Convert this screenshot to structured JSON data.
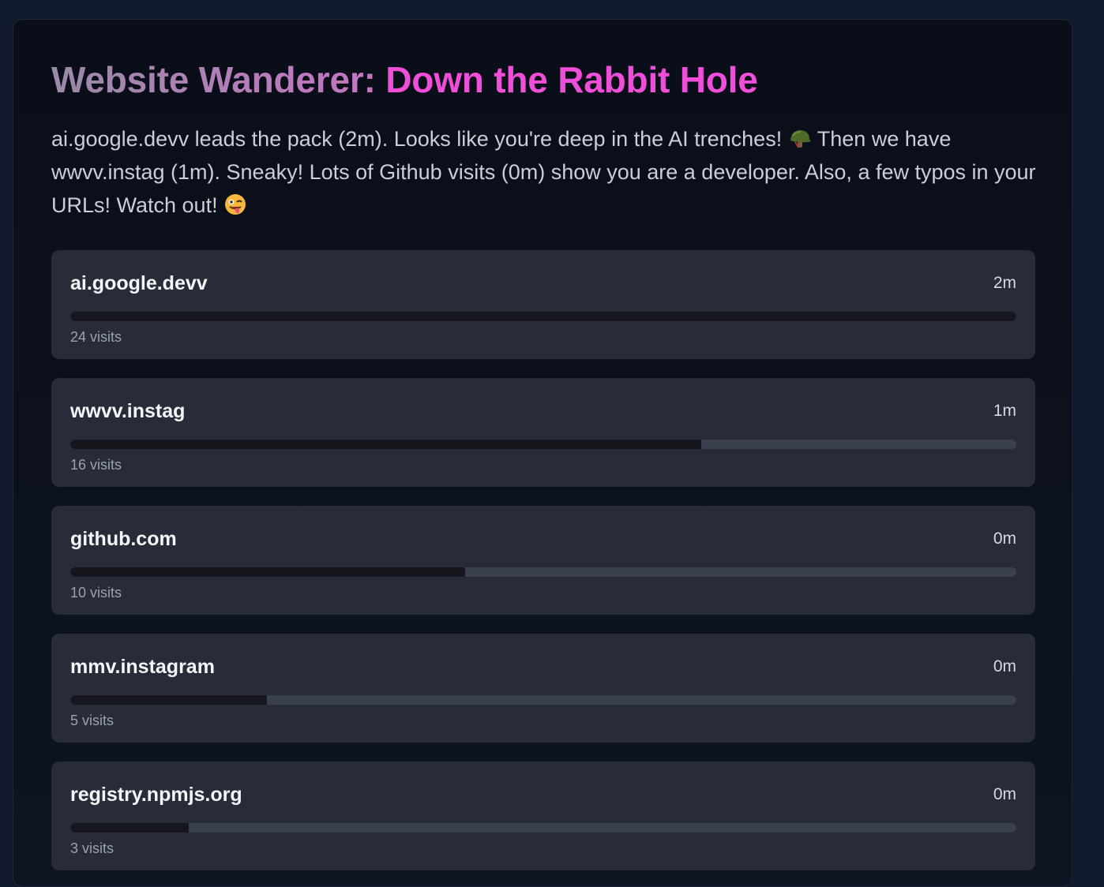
{
  "header": {
    "title_lead": "Website Wanderer: ",
    "title_accent": "Down the Rabbit Hole"
  },
  "summary": {
    "part1": "ai.google.devv leads the pack (2m). Looks like you're deep in the AI trenches!",
    "emoji1": "helmet-emoji",
    "part2": "Then we have wwvv.instag (1m). Sneaky! Lots of Github visits (0m) show you are a developer. Also, a few typos in your URLs! Watch out!",
    "emoji2": "winking-tongue-emoji"
  },
  "sites": [
    {
      "name": "ai.google.devv",
      "time": "2m",
      "visits": "24 visits",
      "fill": 1.0
    },
    {
      "name": "wwvv.instag",
      "time": "1m",
      "visits": "16 visits",
      "fill": 0.667
    },
    {
      "name": "github.com",
      "time": "0m",
      "visits": "10 visits",
      "fill": 0.417
    },
    {
      "name": "mmv.instagram",
      "time": "0m",
      "visits": "5 visits",
      "fill": 0.208
    },
    {
      "name": "registry.npmjs.org",
      "time": "0m",
      "visits": "3 visits",
      "fill": 0.125
    }
  ],
  "colors": {
    "page_bg": "#111a2c",
    "card_bg": "#272c38",
    "accent": "#ef4ed9",
    "bar_track": "#3a404d",
    "bar_fill": "#15171d"
  }
}
